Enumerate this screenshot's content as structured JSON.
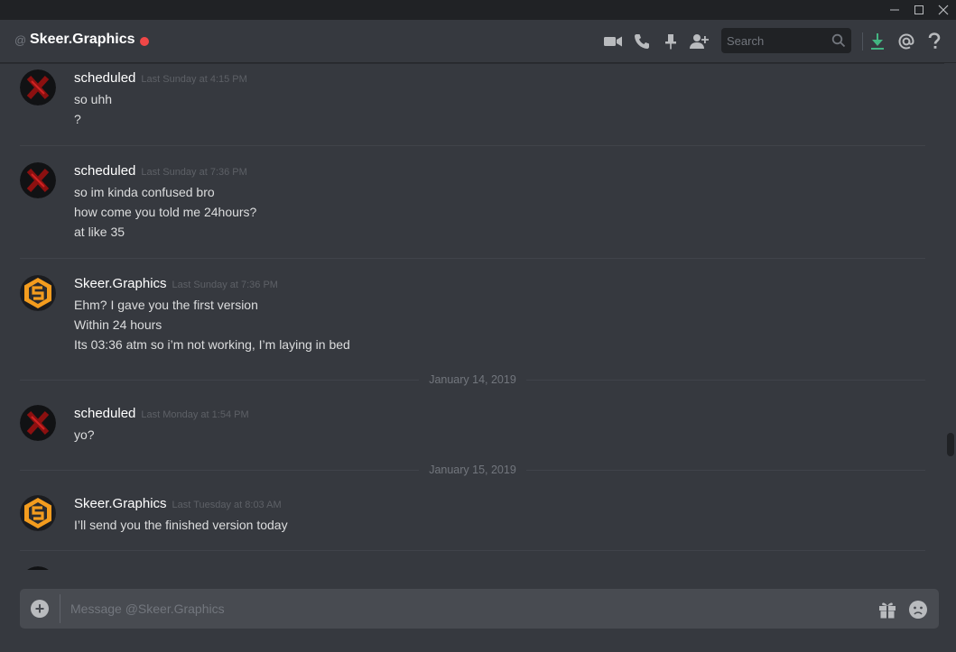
{
  "titlebar": {
    "controls": [
      "minimize-icon",
      "maximize-icon",
      "close-icon"
    ]
  },
  "header": {
    "at_symbol": "@",
    "dm_name": "Skeer.Graphics",
    "status_color": "#f04747",
    "search_placeholder": "Search",
    "icons": [
      "video-call-icon",
      "voice-call-icon",
      "pin-icon",
      "add-friend-icon",
      "search-icon",
      "download-icon",
      "mentions-icon",
      "help-icon"
    ]
  },
  "messages": [
    {
      "author": "scheduled",
      "timestamp": "Last Sunday at 4:15 PM",
      "avatar": "x-avatar",
      "lines": [
        "so uhh",
        "?"
      ]
    },
    {
      "author": "scheduled",
      "timestamp": "Last Sunday at 7:36 PM",
      "avatar": "x-avatar",
      "lines": [
        "so im kinda confused bro",
        "how come you told me 24hours?",
        "at like 35"
      ]
    },
    {
      "author": "Skeer.Graphics",
      "timestamp": "Last Sunday at 7:36 PM",
      "avatar": "s-logo-avatar",
      "lines": [
        "Ehm? I gave you the first version",
        "Within 24 hours",
        "Its 03:36 atm so i’m not working, I’m laying in bed"
      ]
    },
    {
      "date_divider": "January 14, 2019"
    },
    {
      "author": "scheduled",
      "timestamp": "Last Monday at 1:54 PM",
      "avatar": "x-avatar",
      "lines": [
        "yo?"
      ]
    },
    {
      "date_divider": "January 15, 2019"
    },
    {
      "author": "Skeer.Graphics",
      "timestamp": "Last Tuesday at 8:03 AM",
      "avatar": "s-logo-avatar",
      "lines": [
        "I’ll send you the finished version today"
      ]
    }
  ],
  "composer": {
    "placeholder": "Message @Skeer.Graphics",
    "icons": [
      "add-attachment-icon",
      "gift-icon",
      "emoji-icon"
    ]
  },
  "colors": {
    "background": "#36393f",
    "titlebar": "#202225",
    "composer": "#484b51",
    "avatar_orange": "#f39c1e",
    "download_green": "#43b581"
  }
}
